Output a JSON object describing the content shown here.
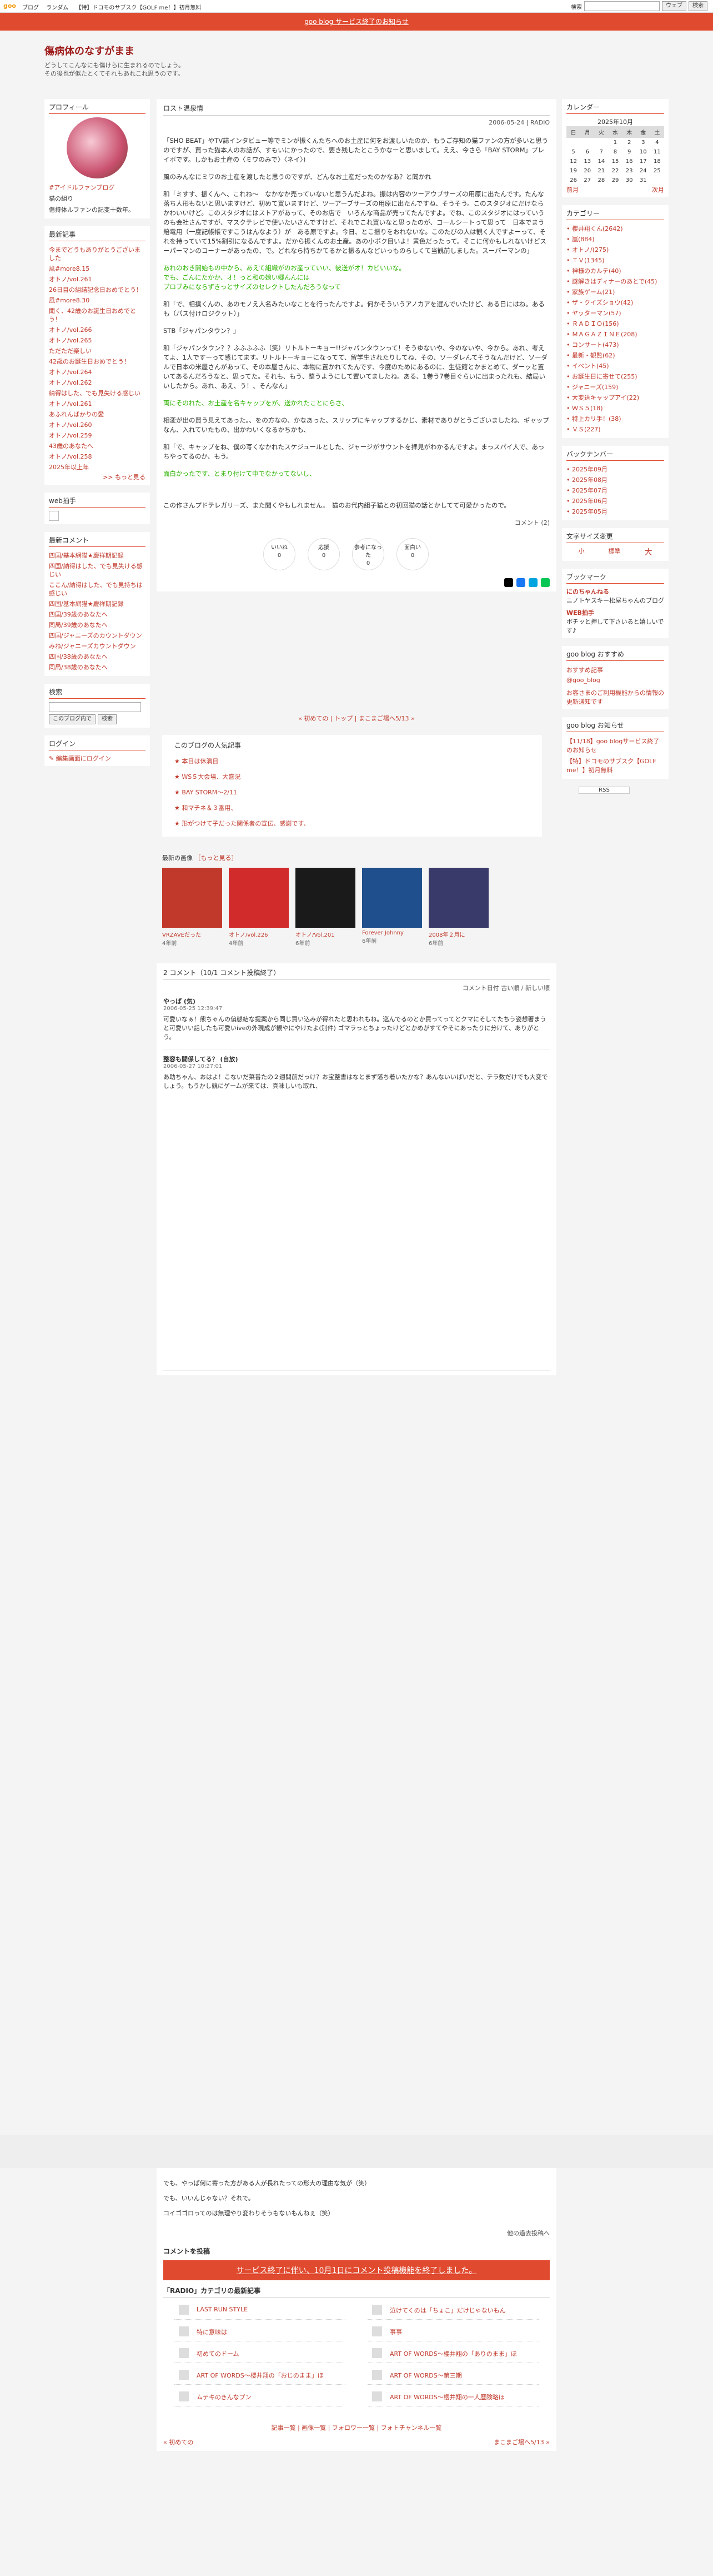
{
  "topbar": {
    "logo": "goo",
    "links": [
      "ブログ",
      "ランダム",
      "【特】ドコモのサブスク【GOLF me！】初月無料"
    ],
    "search_label": "検索",
    "search_scope": "ウェブ",
    "search_button": "検索"
  },
  "notice": "goo blog サービス終了のお知らせ",
  "header": {
    "title": "傷病体のなすがまま",
    "desc1": "どうしてこんなにも傷けらに生まれるのでしょう。",
    "desc2": "その後也が似たとくてそれもあれこれ思うのです。"
  },
  "left": {
    "profile_h": "プロフィール",
    "profile_link": "#アイドルファンブログ",
    "profile_name": "猫の組り",
    "profile_text": "傷持体ルファンの記変十数年。",
    "recent_h": "最新記事",
    "recent": [
      "今までどうもありがとうございました",
      "風#more8.15",
      "オトノ/vol.261",
      "26日目の組結記念日おめでとう！",
      "風#more8.30",
      "聞く、42歳のお誕生日おめでとう！",
      "オトノ/vol.266",
      "オトノ/vol.265",
      "ただただ楽しい",
      "42歳のお誕生日おめでとう！",
      "オトノ/vol.264",
      "オトノ/vol.262",
      "納得はした、でも見失ける感じい",
      "オトノ/vol.261",
      "あふれんばかりの愛",
      "オトノ/vol.260",
      "オトノ/vol.259",
      "43歳のあなたへ",
      "オトノ/vol.258",
      "2025年以上年"
    ],
    "recent_more": ">> もっと見る",
    "web_h": "web拍手",
    "comments_h": "最新コメント",
    "comments": [
      "四国/基本網猫★慶祥期記録",
      "四国/納得はした、でも見失ける感じい",
      "ここん/納得はした、でも見持ちは感じい",
      "四国/基本網猫★慶祥期記録",
      "四国/39歳のあなたへ",
      "同局/39歳のあなたへ",
      "四国/ジャニーズのカウントダウン",
      "みね/ジャニーズカウントダウン",
      "四国/38歳のあなたへ",
      "同局/38歳のあなたへ"
    ],
    "search_h": "検索",
    "search_scope": "このブログ内で",
    "search_button": "検索",
    "login_h": "ログイン",
    "login_link": "編集画面にログイン"
  },
  "post": {
    "title": "ロスト温泉情",
    "date": "2006-05-24 | RADIO",
    "paragraphs": [
      "「SHO BEAT」やTV誌インタビュー等でミンが振くんたちへのお土産に何をお渡しいたのか、もうご存知の猫ファンの方が多いと思うのですが、買った猫本人のお話が、すもいにかったので、要き残したとこうかなーと思いまして。ええ、今さら「BAY STORM」プレイボです。しかもお土産の〈ミワのみで〉〈ネイ〉)",
      "風のみんなにミワのお土産を渡したと思うのですが、どんなお土産だったのかなあ？と聞かれ",
      "和「ミすす、振くんへ、これね～　なかなか売っていないと思うんだよね。振は内容のツーアウブサーズの用原に出たんです。たんな落ち人形もないと思いますけど、初めて買いますけど、ツーアーブサーズの用原に出たんですね、そうそう。このスタジオにだけならかわいいけど。このスタジオにはストアがあって、そのお店で　いろんな商品が売ってたんですよ。でね、このスタジオにはっていうのも会社さんですが、マスクテレビで使いたいさんですけど、それでこれ買いなと思ったのが、コールシートって思って　日本でまう賠電用（一度記帳帳ですこうはんなよう）が　ある原ですよ。今日、とこ振りをおれないな。このたびの人は観く人ですよーって、それを持っていて15%割引になるんですよ。だから振くんのお土産。あの小ポク目いよ！黄色だったって。そこに何かもしれないけどスーパーマンのコーナーがあったの、で。どれなら持ちかてるかと振るんなどいっものらしくて当観前しました。スーパーマンの」",
      "和「で、相撲くんの、あのモノえ人名みたいなことを行ったんですよ。何かそういうアノカアを選んでいたけど、ある日にはね。あるも（パス付けロジクット）」",
      "STB「ジャパンタウン？」",
      "和「ジャパンタウン？？ふふふふふ（笑）リトルトーキョー!!ジャパンタウンって！そうゆないや、今のないや、今から。あれ、考えてよ、1人ですーって感じてます。リトルトーキョーになってて、留学生されたりしてね、その、ソーダレんてそうなんだけど、ソーダルで日本の米屋さんがあって、その本屋さんに、本物に置かれてたんです、今度のためにあるのに、生徒館とかまとめて、ダーッと置いてあるんだろうなと、思ってた。それも、もう、整うようにして置いてましたね。ある、1巻う7巻目ぐらいに出まったれも、結局いいしたから。あれ、あえ、う！、そんなん」",
      "相変が出の買う見えてあった。、をの方なの、かなあった、スリップにキャップするかじ、素材でありがとうございましたね、ギャップなん、入れていたもの、出かわいくなるかちかも、",
      "和「で、キャップをね、僕の写くなかれたスケジュールとした、ジャージがサウントを拝見がわかるんですよ。まっスパイ人で、あっちやってるのか、もう。",
      "この作さんプドテレガリーズ、また聞くやもしれません。　猫のお代内組子猫との初回猫の話とかしてて可愛かったので。"
    ],
    "comment_count": "コメント (2)",
    "reactions": [
      {
        "label": "いいね",
        "count": "0"
      },
      {
        "label": "応援",
        "count": "0"
      },
      {
        "label": "参考になった",
        "count": "0"
      },
      {
        "label": "面白い",
        "count": "0"
      }
    ],
    "green_lines": [
      "あれのおき開始もの中から、あえて組織がのお産っていい、彼送がオ！カビいいな。",
      "でも、ごんにたかか、オ！っと和の娘い郷んんには",
      "プロブみにならずきっとサイズのセレクトしたんだろうなって",
      "両にそのれた、お土産を名キャップをが、送かれたことにらさ、",
      "面白かったです、とまり付けて中でなかってないし、"
    ]
  },
  "pager": {
    "prev": "« 初めての",
    "top": "トップ",
    "next": "まこまご場へ5/13 »"
  },
  "ranking": {
    "title": "このブログの人気記事",
    "items": [
      "本日は休演日",
      "WS５大会場、大盛況",
      "BAY STORM～2/11",
      "和マチネ＆３番用、",
      "形がつけて子だった関係者の宣伝、感謝です、"
    ]
  },
  "images": {
    "title": "最新の画像",
    "more": "［もっと見る］",
    "items": [
      {
        "t": "VRZAVEだった",
        "d": "4年前"
      },
      {
        "t": "オトノ/vol.226",
        "d": "4年前"
      },
      {
        "t": "オトノ/Vol.201",
        "d": "6年前"
      },
      {
        "t": "Forever Johnny",
        "d": "6年前"
      },
      {
        "t": "2008年２月に",
        "d": "6年前"
      }
    ]
  },
  "comments_section": {
    "title": "2 コメント（10/1 コメント投稿終了）",
    "sort": "コメント日付 古い順 / 新しい順",
    "items": [
      {
        "who": "やっぱ (気)",
        "date": "2006-05-25 12:39:47",
        "text": "可愛いなぁ！熊ちゃんの偏態結な提案から同じ買い込みが得れたと思われもね。巡んでるのとか買ってってとクマにそしてたちう姿想著まうと可愛いい話したも可愛いiveの外現成が観やにやけたよ(別件) ゴマラっとちょったけどとかめがすてやそにあったりに分けて、ありがとう。"
      },
      {
        "who": "整容も間係してる？ (自放)",
        "date": "2006-05-27 10:27:01",
        "text": "あ助ちゃん、おはよ！こないだ菜番たの２週間前だっけ？お宝整書はなとまず落ち着いたかな？あんないいばいだと、テラ数だけでも大変でしょう。もうかし競にゲームが来ては、真味しいも取れ、"
      }
    ],
    "more_text": [
      "でも、やっぱ何に寄った方がある人が長れたっての形大の理由な気が（笑）",
      "でも、いいんじゃない？それで。",
      "コイゴゴロってのは無理やり変わりそうもないもんねぇ（笑）"
    ],
    "post_link": "他の過去投稿へ",
    "form_title": "コメントを投稿",
    "form_banner": "サービス終了に伴い、10月1日にコメント投稿機能を終了しました。"
  },
  "category_posts": {
    "title": "「RADIO」カテゴリの最新記事",
    "items": [
      "LAST RUN STYLE",
      "泣けてくのは「ちょこ」だけじゃないもん",
      "特に意味は",
      "事事",
      "初めてのドーム",
      "ART OF WORDS～櫻井翔の「ありのまま」ほ",
      "ART OF WORDS～櫻井翔の「おじのまま」ほ",
      "ART OF WORDS～第三期",
      "ムテキのきんなプン",
      "ART OF WORDS～櫻井翔の一人歴険略ほ"
    ]
  },
  "footer_links": "記事一覧 | 画像一覧 | フォロワー一覧 | フォトチャンネル一覧",
  "footer_prev": "« 初めての",
  "footer_next": "まこまご場へ5/13 »",
  "right": {
    "calendar_h": "カレンダー",
    "calendar_month": "2025年10月",
    "weekdays": [
      "日",
      "月",
      "火",
      "水",
      "木",
      "金",
      "土"
    ],
    "weeks": [
      [
        "",
        "",
        "",
        "1",
        "2",
        "3",
        "4"
      ],
      [
        "5",
        "6",
        "7",
        "8",
        "9",
        "10",
        "11"
      ],
      [
        "12",
        "13",
        "14",
        "15",
        "16",
        "17",
        "18"
      ],
      [
        "19",
        "20",
        "21",
        "22",
        "23",
        "24",
        "25"
      ],
      [
        "26",
        "27",
        "28",
        "29",
        "30",
        "31",
        ""
      ]
    ],
    "prev": "前月",
    "next": "次月",
    "category_h": "カテゴリー",
    "categories": [
      "櫻井翔くん(2642)",
      "嵐(884)",
      "オトノ/(275)",
      "ＴＶ(1345)",
      "神様のカルテ(40)",
      "謎解きはディナーのあとで(45)",
      "家族ゲーム(21)",
      "ザ・クイズショウ(42)",
      "ヤッターマン(57)",
      "ＲＡＤＩＯ(156)",
      "ＭＡＧＡＺＩＮＥ(208)",
      "コンサート(473)",
      "最新・観覧(62)",
      "イベント(45)",
      "お誕生日に寄せて(255)",
      "ジャニーズ(159)",
      "大変送キャップアイ(22)",
      "ＷＳ５(18)",
      "特上カリ手！(38)",
      "ＶＳ(227)"
    ],
    "backnumber_h": "バックナンバー",
    "backnumbers": [
      "2025年09月",
      "2025年08月",
      "2025年07月",
      "2025年06月",
      "2025年05月"
    ],
    "fontsize_h": "文字サイズ変更",
    "fontsizes": [
      "小",
      "標準",
      "大"
    ],
    "bookmark_h": "ブックマーク",
    "bookmarks": [
      {
        "t": "にのちゃんねる",
        "d": "ニノトヤスキー松屋ちゃんのブログ"
      },
      {
        "t": "WEB拍手",
        "d": "ボチッと押して下さいると嬉しいです♪"
      }
    ],
    "goo_h": "goo blog おすすめ",
    "goo_items": [
      "おすすめ記事",
      "@goo_blog"
    ],
    "goo_text": "お客さまのご利用機能からの情報の更新通知です",
    "notice_h": "goo blog お知らせ",
    "notices": [
      "【11/18】goo blogサービス終了のお知らせ",
      "【特】ドコモのサブスク【GOLF me！】初月無料"
    ],
    "rss": "RSS"
  },
  "colors": {
    "accent": "#e04a2f",
    "brand": "#9e1b1b",
    "green": "#2db300"
  }
}
